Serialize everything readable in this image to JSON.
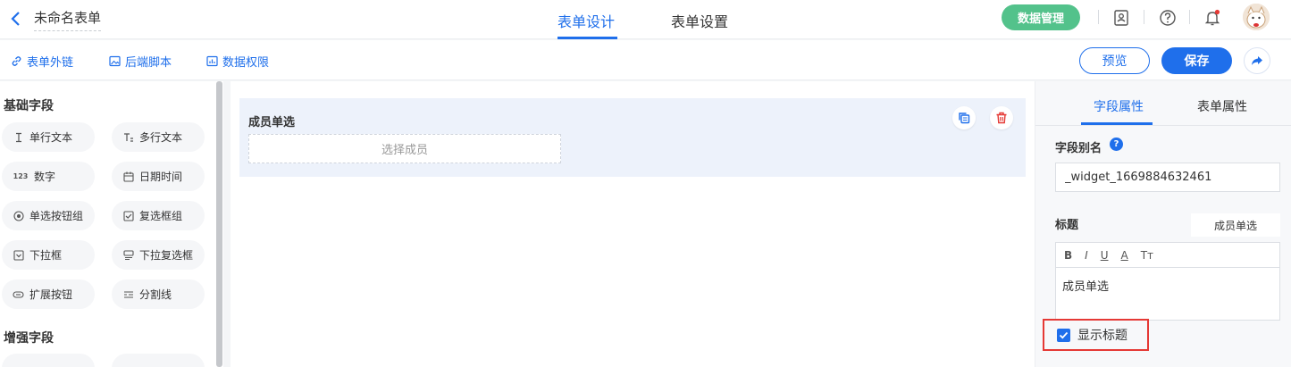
{
  "header": {
    "form_title": "未命名表单",
    "tabs": [
      {
        "label": "表单设计",
        "active": true
      },
      {
        "label": "表单设置",
        "active": false
      }
    ],
    "data_manage_label": "数据管理"
  },
  "toolbar": {
    "items": [
      {
        "label": "表单外链",
        "icon": "link-icon"
      },
      {
        "label": "后端脚本",
        "icon": "image-icon"
      },
      {
        "label": "数据权限",
        "icon": "chart-icon"
      }
    ],
    "preview_label": "预览",
    "save_label": "保存"
  },
  "palette": {
    "basic_title": "基础字段",
    "basic_fields": [
      {
        "label": "单行文本",
        "icon": "text-cursor-icon"
      },
      {
        "label": "多行文本",
        "icon": "multiline-text-icon"
      },
      {
        "label": "数字",
        "icon": "number-icon",
        "glyph": "123"
      },
      {
        "label": "日期时间",
        "icon": "calendar-icon"
      },
      {
        "label": "单选按钮组",
        "icon": "radio-icon"
      },
      {
        "label": "复选框组",
        "icon": "checkbox-icon"
      },
      {
        "label": "下拉框",
        "icon": "dropdown-icon"
      },
      {
        "label": "下拉复选框",
        "icon": "dropdown-multi-icon"
      },
      {
        "label": "扩展按钮",
        "icon": "extend-button-icon"
      },
      {
        "label": "分割线",
        "icon": "divider-icon"
      }
    ],
    "enhanced_title": "增强字段"
  },
  "canvas": {
    "field_label": "成员单选",
    "placeholder": "选择成员"
  },
  "props": {
    "tabs": [
      {
        "label": "字段属性",
        "active": true
      },
      {
        "label": "表单属性",
        "active": false
      }
    ],
    "alias_label": "字段别名",
    "help_glyph": "?",
    "alias_value": "_widget_1669884632461",
    "title_label": "标题",
    "title_value": "成员单选",
    "editor_tools": [
      "B",
      "I",
      "U",
      "A",
      "Tт"
    ],
    "editor_text": "成员单选",
    "show_title_label": "显示标题",
    "show_title_checked": true
  },
  "colors": {
    "primary": "#1f6feb",
    "success": "#53c28b",
    "danger": "#e53935"
  }
}
